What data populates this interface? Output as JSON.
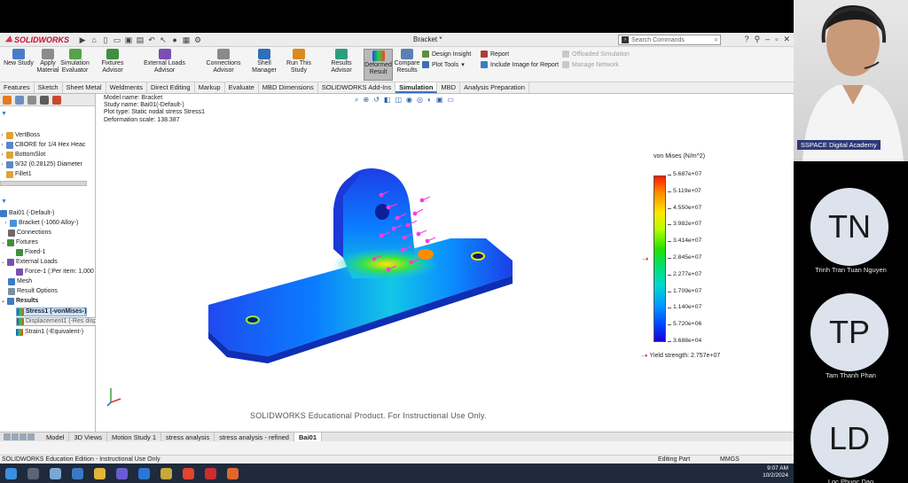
{
  "app": {
    "brand": "SOLIDWORKS",
    "doc_title": "Bracket *",
    "search_placeholder": "Search Commands"
  },
  "ribbon": {
    "new_study": "New Study",
    "apply_material": "Apply Material",
    "simulation_evaluator": "Simulation Evaluator",
    "fixtures_advisor": "Fixtures Advisor",
    "external_loads_advisor": "External Loads Advisor",
    "connections_advisor": "Connections Advisor",
    "shell_manager": "Shell Manager",
    "run_this_study": "Run This Study",
    "results_advisor": "Results Advisor",
    "deformed_result": "Deformed Result",
    "compare_results": "Compare Results",
    "design_insight": "Design Insight",
    "plot_tools": "Plot Tools",
    "report": "Report",
    "include_image": "Include Image for Report",
    "offloaded_sim": "Offloaded Simulation",
    "manage_network": "Manage Network"
  },
  "tabs": [
    "Features",
    "Sketch",
    "Sheet Metal",
    "Weldments",
    "Direct Editing",
    "Markup",
    "Evaluate",
    "MBD Dimensions",
    "SOLIDWORKS Add-Ins",
    "Simulation",
    "MBD",
    "Analysis Preparation"
  ],
  "tree": {
    "vertboss": "VertBoss",
    "cbore": "CBORE for 1/4 Hex Heac",
    "bottomslot": "BottomSlot",
    "diameter": "9/32 (0.28125) Diameter",
    "fillet": "Fillet1",
    "study": "Bai01 (-Default-)",
    "bracket": "Bracket (-1060 Alloy-)",
    "connections": "Connections",
    "fixtures": "Fixtures",
    "fixed": "Fixed-1",
    "external_loads": "External Loads",
    "force": "Force-1 (:Per item: 1,000",
    "mesh": "Mesh",
    "result_options": "Result Options",
    "results": "Results",
    "stress": "Stress1 (-vonMises-)",
    "displacement": "Displacement1 (-Res disp-)",
    "strain": "Strain1 (-Equivalent-)"
  },
  "viewport": {
    "model_name": "Model name: Bracket",
    "study_name": "Study name: Bai01(-Default-)",
    "plot_type": "Plot type: Static nodal stress Stress1",
    "deformation": "Deformation scale: 138.387",
    "watermark": "SOLIDWORKS Educational Product. For Instructional Use Only."
  },
  "legend": {
    "title": "von Mises (N/m^2)",
    "ticks": [
      "5.687e+07",
      "5.119e+07",
      "4.550e+07",
      "3.982e+07",
      "3.414e+07",
      "2.845e+07",
      "2.277e+07",
      "1.709e+07",
      "1.140e+07",
      "5.720e+06",
      "3.688e+04"
    ],
    "yield_text": "Yield strength: 2.757e+07"
  },
  "bottom_tabs": [
    "Model",
    "3D Views",
    "Motion Study 1",
    "stress analysis",
    "stress analysis - refined",
    "Bai01"
  ],
  "status": {
    "left": "SOLIDWORKS Education Edition - Instructional Use Only",
    "mode": "Editing Part",
    "units": "MMGS",
    "time": "9:07 AM",
    "date": "10/2/2024"
  },
  "participants": {
    "presenter_label": "SSPACE Digital Academy",
    "people": [
      {
        "initials": "TN",
        "name": "Trinh Tran Tuan Nguyen"
      },
      {
        "initials": "TP",
        "name": "Tam Thanh Phan"
      },
      {
        "initials": "LD",
        "name": "Loc Phuoc Dao"
      }
    ]
  }
}
